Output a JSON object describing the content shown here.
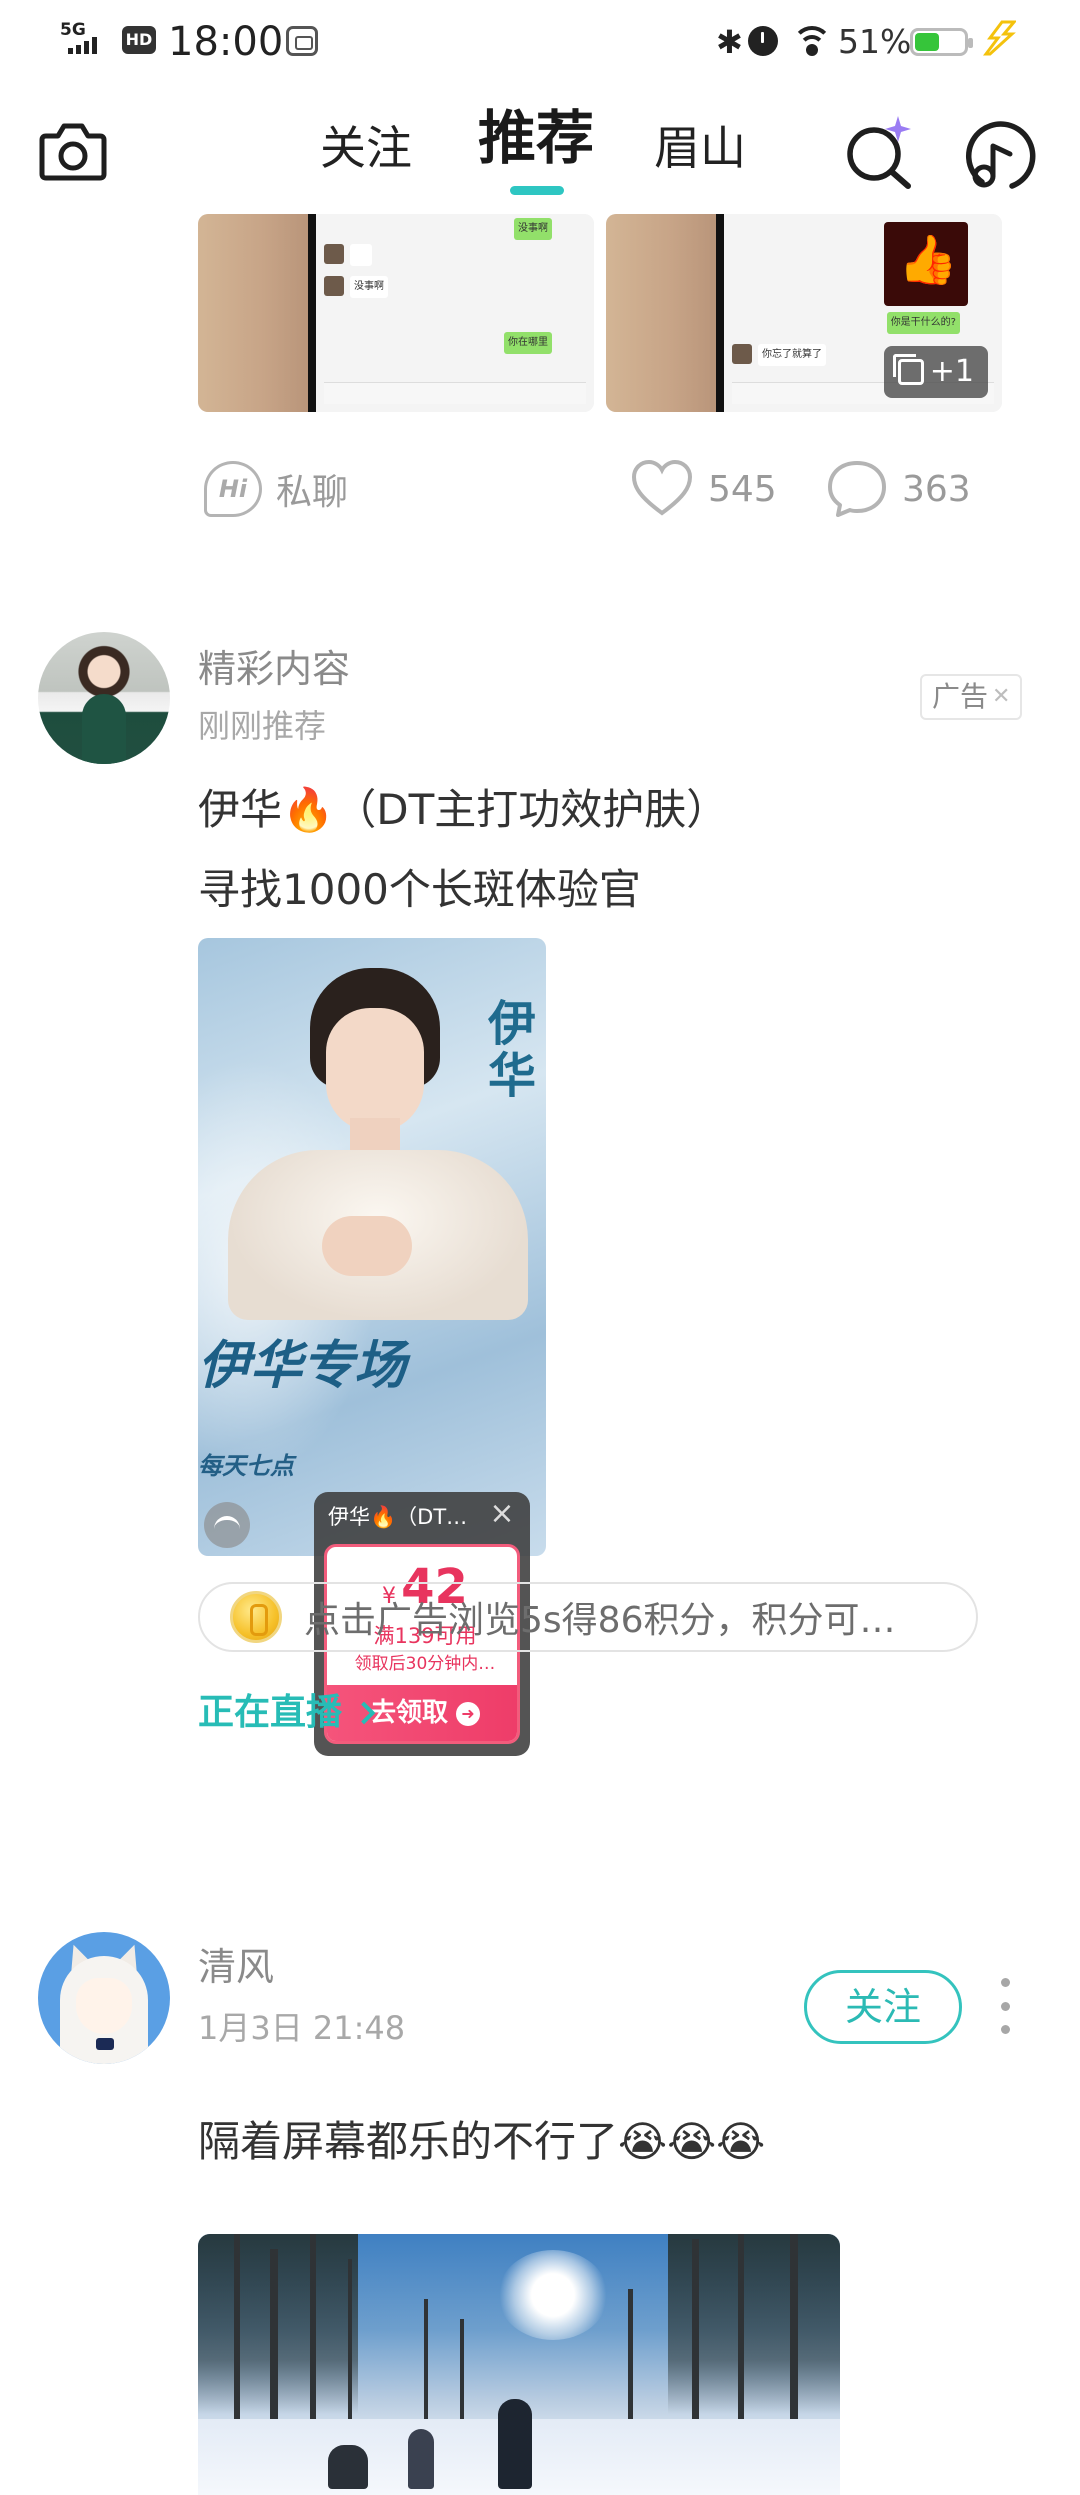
{
  "status_bar": {
    "network": "5G",
    "hd": "HD",
    "time": "18:00",
    "battery_percent": "51%",
    "battery_level": 0.51,
    "colors": {
      "battery": "#36c53a",
      "charge_bolt": "#f4c20d"
    }
  },
  "top_nav": {
    "tabs": [
      {
        "label": "关注"
      },
      {
        "label": "推荐",
        "active": true
      },
      {
        "label": "眉山"
      }
    ],
    "accent": "#2ec6c2",
    "icons": [
      "camera-icon",
      "ai-search-icon",
      "music-circle-icon"
    ]
  },
  "feed": {
    "post1": {
      "image_more": "+1",
      "chat_texts": [
        "没事啊",
        "你在哪里",
        "你是干什么的?",
        "你忘了就算了"
      ],
      "private_chat_label": "私聊",
      "likes": "545",
      "comments": "363"
    },
    "ad_post": {
      "author": "精彩内容",
      "subtitle": "刚刚推荐",
      "ad_label": "广告",
      "text_line1": "伊华🔥（DT主打功效护肤）",
      "text_line2": "寻找1000个长斑体验官",
      "image_brand": "伊华",
      "image_banner": "伊华专场",
      "image_banner_sub": "每天七点",
      "coupon": {
        "title": "伊华🔥（DT…",
        "currency": "¥",
        "amount": "42",
        "condition": "满139可用",
        "validity": "领取后30分钟内…",
        "claim_label": "去领取"
      },
      "points_text": "点击广告浏览5s得86积分，积分可…",
      "live_label": "正在直播"
    },
    "post3": {
      "author": "清风",
      "timestamp": "1月3日 21:48",
      "follow_label": "关注",
      "text": "隔着屏幕都乐的不行了😭😭😭"
    }
  }
}
